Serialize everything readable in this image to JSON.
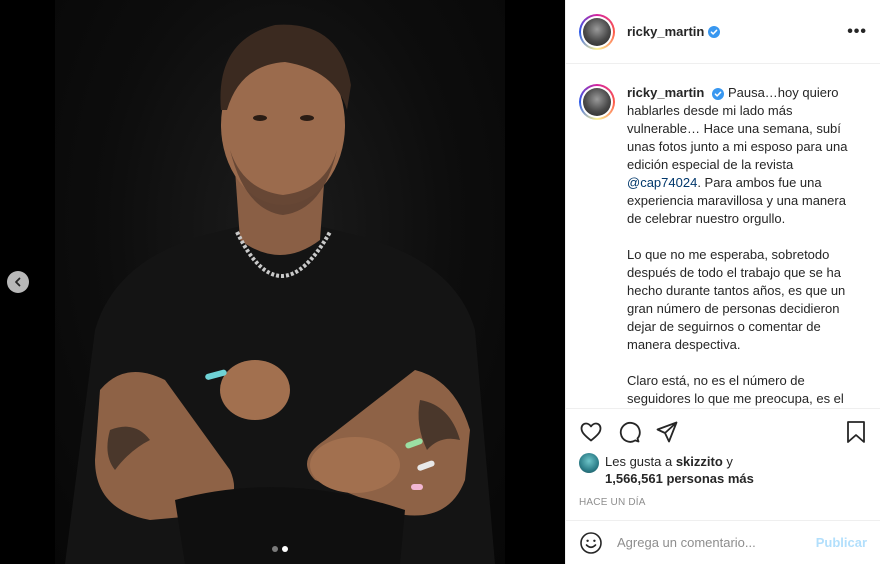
{
  "post": {
    "username": "ricky_martin",
    "verified": true,
    "more_label": "•••"
  },
  "media": {
    "carousel_count": 2,
    "carousel_active_index": 1
  },
  "caption": {
    "username": "ricky_martin",
    "paragraph_1_before_mention": " Pausa…hoy quiero hablarles desde mi lado más vulnerable… Hace una semana, subí unas fotos junto a mi esposo para una edición especial de la revista ",
    "mention": "@cap74024",
    "paragraph_1_after_mention": ". Para ambos fue una experiencia maravillosa y una manera de celebrar nuestro orgullo.",
    "paragraph_2": "Lo que no me esperaba, sobretodo después de todo el trabajo que se ha hecho durante tantos años, es que un gran número de personas decidieron dejar de seguirnos o comentar de manera despectiva.",
    "paragraph_3": "Claro está, no es el número de seguidores lo que me preocupa, es el mensaje qué hay detrás de su decisión."
  },
  "likes": {
    "prefix": "Les gusta a ",
    "user": "skizzito",
    "conjunction": " y",
    "count": "1,566,561 personas más"
  },
  "timestamp": "HACE UN DÍA",
  "comment": {
    "placeholder": "Agrega un comentario...",
    "post_label": "Publicar"
  },
  "colors": {
    "verified": "#3897f0",
    "mention": "#00376b",
    "post_disabled": "#b2dffc"
  },
  "icons": [
    "chevron-left-icon",
    "verified-badge-icon",
    "more-options-icon",
    "heart-icon",
    "comment-icon",
    "share-icon",
    "bookmark-icon",
    "emoji-icon"
  ]
}
